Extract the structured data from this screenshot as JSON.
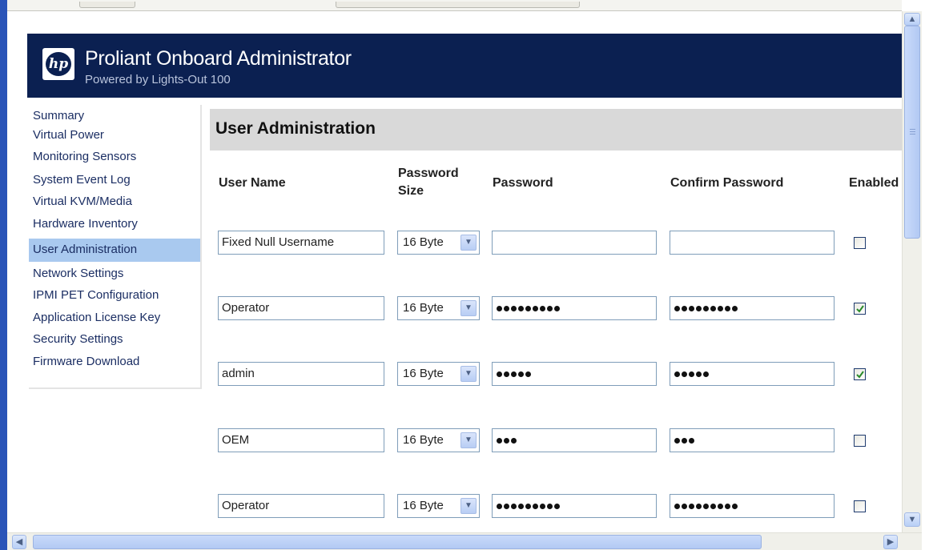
{
  "banner": {
    "logo": "hp",
    "title": "Proliant Onboard Administrator",
    "subtitle": "Powered by Lights-Out 100"
  },
  "nav": {
    "items": [
      "Summary",
      "Virtual Power",
      "Monitoring Sensors",
      "System Event Log",
      "Virtual KVM/Media",
      "Hardware Inventory",
      "User Administration",
      "Network Settings",
      "IPMI PET Configuration",
      "Application License Key",
      "Security Settings",
      "Firmware Download"
    ],
    "selected": "User Administration"
  },
  "page": {
    "title": "User Administration",
    "columns": {
      "user_name": "User Name",
      "password_size_line1": "Password",
      "password_size_line2": "Size",
      "password": "Password",
      "confirm_password": "Confirm Password",
      "enabled": "Enabled"
    }
  },
  "users": [
    {
      "username": "Fixed Null Username",
      "password_size": "16 Byte",
      "password_dots": 0,
      "confirm_dots": 0,
      "enabled": false
    },
    {
      "username": "Operator",
      "password_size": "16 Byte",
      "password_dots": 9,
      "confirm_dots": 9,
      "enabled": true
    },
    {
      "username": "admin",
      "password_size": "16 Byte",
      "password_dots": 5,
      "confirm_dots": 5,
      "enabled": true
    },
    {
      "username": "OEM",
      "password_size": "16 Byte",
      "password_dots": 3,
      "confirm_dots": 3,
      "enabled": false
    },
    {
      "username": "Operator",
      "password_size": "16 Byte",
      "password_dots": 9,
      "confirm_dots": 9,
      "enabled": false
    }
  ],
  "colors": {
    "banner_bg": "#0b2051",
    "nav_link": "#1b2e63",
    "nav_selected_bg": "#a9c9ef",
    "section_bg": "#d9d9d9",
    "checkbox_tick": "#2a8a2a"
  },
  "icons": {
    "scroll_up": "▲",
    "scroll_down": "▼",
    "scroll_left": "◀",
    "scroll_right": "▶",
    "dropdown": "▼"
  }
}
